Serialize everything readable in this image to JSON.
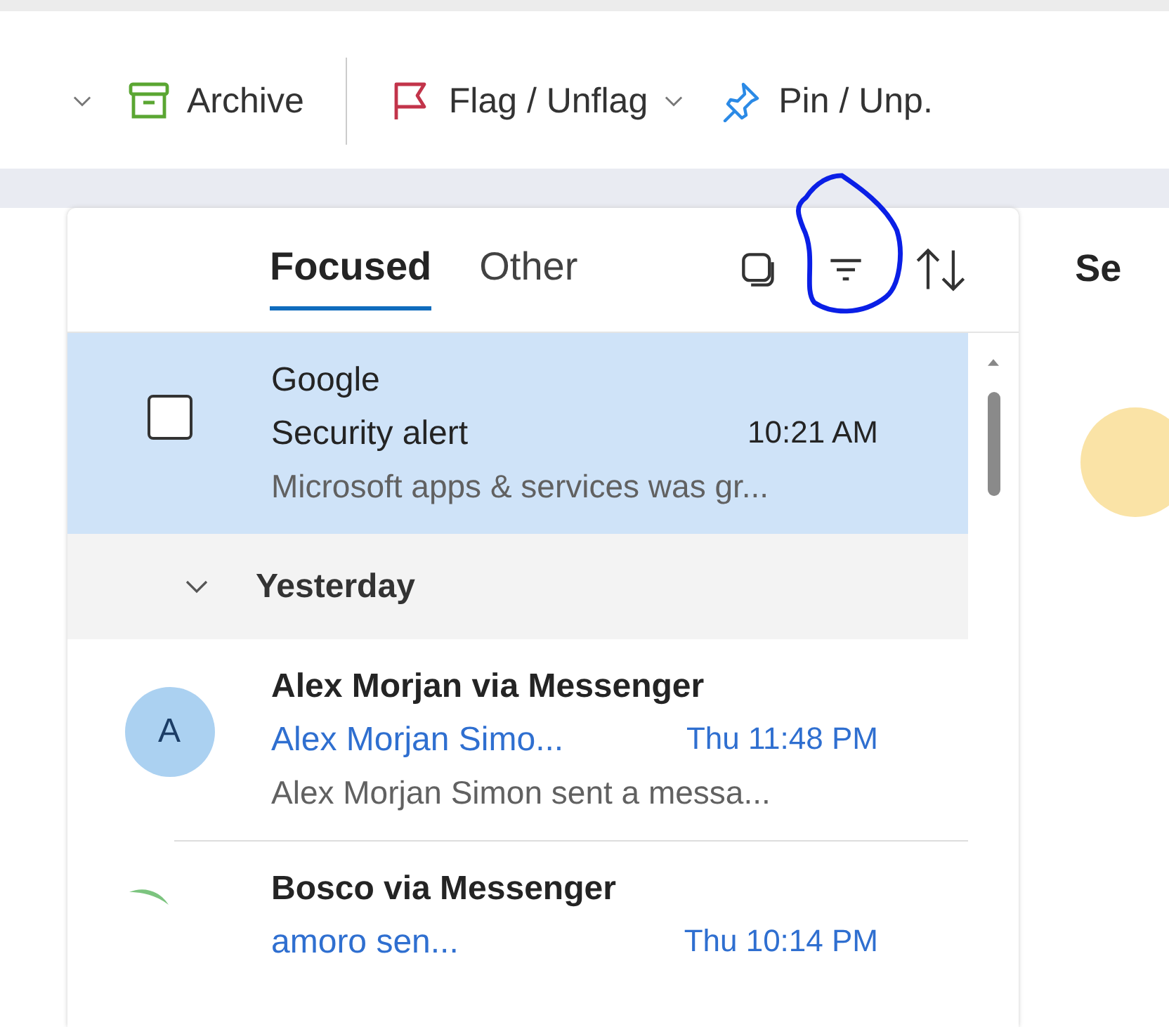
{
  "toolbar": [
    {
      "kind": "chevron",
      "dropdown": true
    },
    {
      "kind": "archive",
      "label": "Archive",
      "dropdown": false
    },
    {
      "kind": "flag",
      "label": "Flag / Unflag",
      "dropdown": true
    },
    {
      "kind": "pin",
      "label": "Pin / Unp.",
      "dropdown": false
    }
  ],
  "tabs": [
    {
      "label": "Focused",
      "selected": true
    },
    {
      "label": "Other",
      "selected": false
    }
  ],
  "messages": [
    {
      "kind": "message",
      "sender": "Google",
      "subject": "Security alert",
      "time": "10:21 AM",
      "preview": "Microsoft apps & services was gr...",
      "selected": true,
      "unread": false,
      "avatar": {
        "kind": "checkbox"
      }
    },
    {
      "kind": "group",
      "label": "Yesterday",
      "expanded": true
    },
    {
      "kind": "message",
      "sender": "Alex Morjan via Messenger",
      "subject": "Alex Morjan Simo...",
      "time": "Thu 11:48 PM",
      "preview": "Alex Morjan Simon sent a messa...",
      "selected": false,
      "unread": true,
      "avatar": {
        "kind": "letter",
        "letter": "A"
      }
    },
    {
      "kind": "message",
      "sender": "Bosco via Messenger",
      "subject": "amoro sen...",
      "time": "Thu 10:14 PM",
      "selected": false,
      "unread": true,
      "avatar": {
        "kind": "leaf"
      }
    }
  ],
  "reading_pane": {
    "title": "Se"
  }
}
